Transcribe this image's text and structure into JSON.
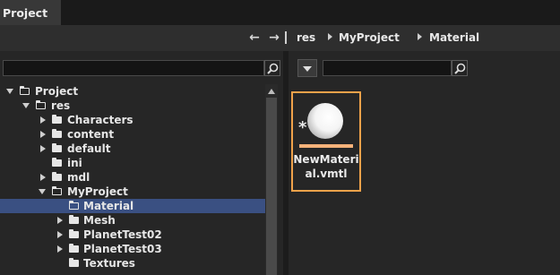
{
  "window": {
    "tab_title": "Project"
  },
  "toolbar": {
    "back_glyph": "←",
    "forward_glyph": "→",
    "breadcrumb": [
      "res",
      "MyProject",
      "Material"
    ]
  },
  "left_panel": {
    "search": {
      "value": "",
      "placeholder": ""
    },
    "tree": [
      {
        "label": "Project",
        "depth": 0,
        "expander": "expanded",
        "icon": "folder-open"
      },
      {
        "label": "res",
        "depth": 1,
        "expander": "expanded",
        "icon": "folder-open"
      },
      {
        "label": "Characters",
        "depth": 2,
        "expander": "collapsed",
        "icon": "folder"
      },
      {
        "label": "content",
        "depth": 2,
        "expander": "collapsed",
        "icon": "folder"
      },
      {
        "label": "default",
        "depth": 2,
        "expander": "collapsed",
        "icon": "folder"
      },
      {
        "label": "ini",
        "depth": 2,
        "expander": "none",
        "icon": "folder"
      },
      {
        "label": "mdl",
        "depth": 2,
        "expander": "collapsed",
        "icon": "folder"
      },
      {
        "label": "MyProject",
        "depth": 2,
        "expander": "expanded",
        "icon": "folder-open"
      },
      {
        "label": "Material",
        "depth": 3,
        "expander": "none",
        "icon": "folder-open",
        "selected": true
      },
      {
        "label": "Mesh",
        "depth": 3,
        "expander": "collapsed",
        "icon": "folder"
      },
      {
        "label": "PlanetTest02",
        "depth": 3,
        "expander": "collapsed",
        "icon": "folder"
      },
      {
        "label": "PlanetTest03",
        "depth": 3,
        "expander": "collapsed",
        "icon": "folder"
      },
      {
        "label": "Textures",
        "depth": 3,
        "expander": "none",
        "icon": "folder"
      }
    ]
  },
  "right_panel": {
    "search": {
      "value": "",
      "placeholder": ""
    },
    "assets": [
      {
        "name": "NewMaterial.vmtl",
        "name_display": "NewMater ial.vmtl",
        "modified_marker": "*",
        "selected": true
      }
    ]
  },
  "colors": {
    "selection": "#3a5082",
    "asset_highlight": "#f0a24a",
    "material_bar": "#f5b27a",
    "background": "#262626"
  }
}
